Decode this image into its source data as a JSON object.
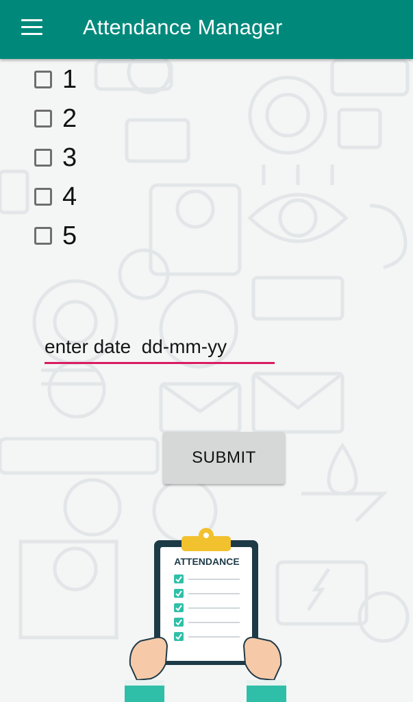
{
  "app_bar": {
    "title": "Attendance Manager",
    "menu_icon": "hamburger-menu-icon",
    "color": "#00897b"
  },
  "checkboxes": [
    {
      "label": "1",
      "checked": false
    },
    {
      "label": "2",
      "checked": false
    },
    {
      "label": "3",
      "checked": false
    },
    {
      "label": "4",
      "checked": false
    },
    {
      "label": "5",
      "checked": false
    }
  ],
  "date_input": {
    "placeholder": "enter date  dd-mm-yy",
    "value": "",
    "underline_color": "#d81b60"
  },
  "submit_button": {
    "label": "SUBMIT"
  },
  "illustration": {
    "clipboard_title": "ATTENDANCE",
    "icon": "attendance-clipboard-illustration"
  }
}
